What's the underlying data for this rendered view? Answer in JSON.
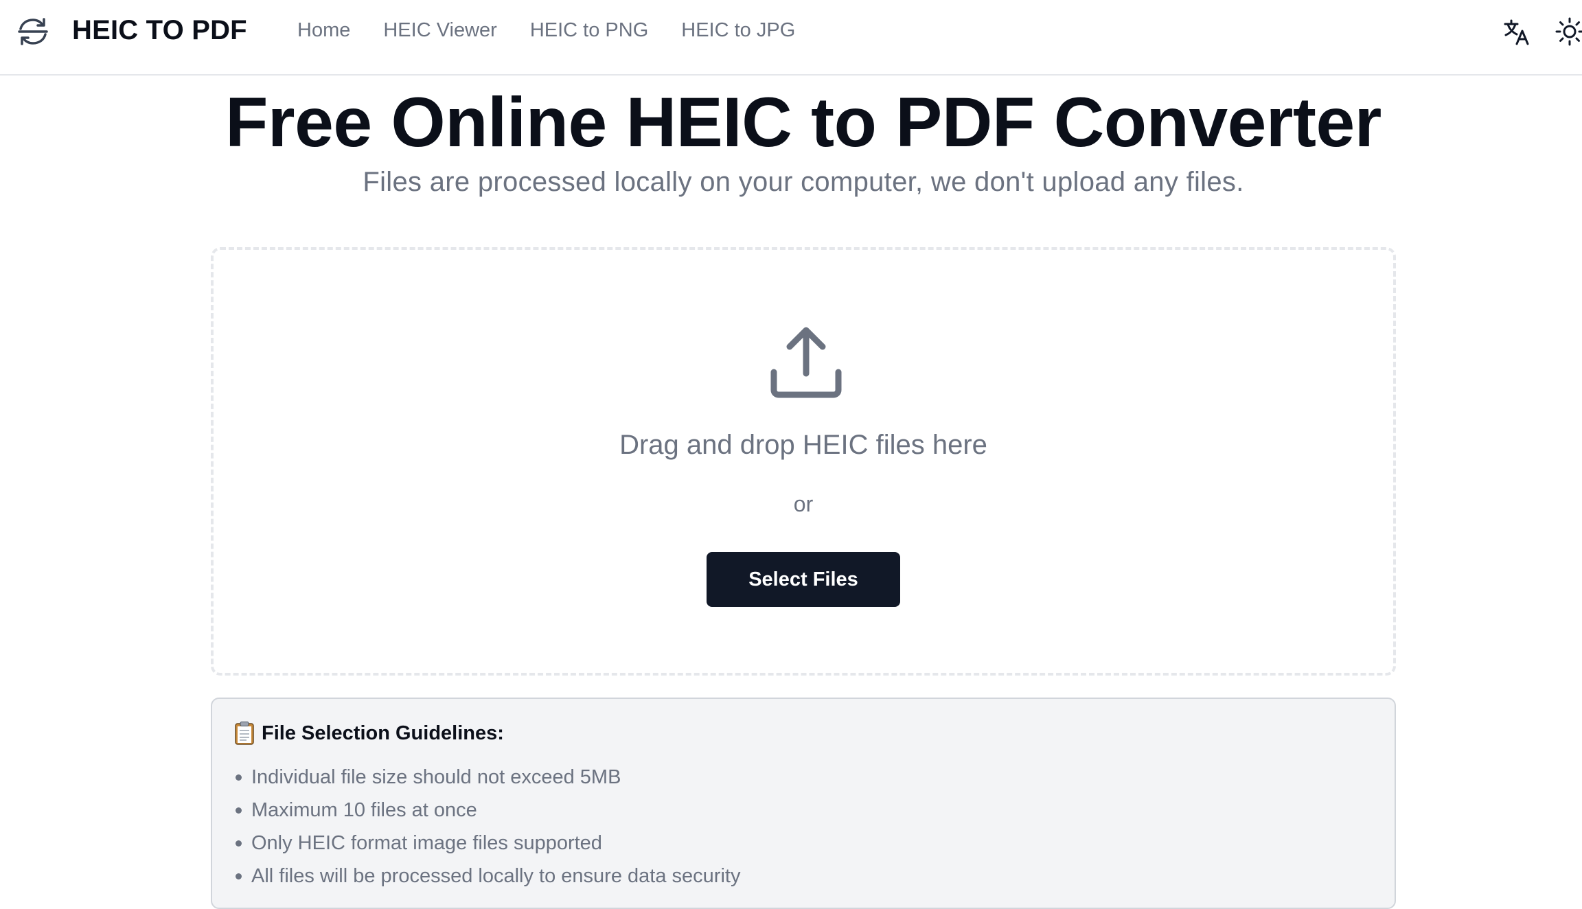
{
  "header": {
    "brand": "HEIC TO PDF",
    "nav": [
      "Home",
      "HEIC Viewer",
      "HEIC to PNG",
      "HEIC to JPG"
    ],
    "icons": {
      "logo": "arrows-exchange-icon",
      "translate": "translate-icon",
      "theme": "sun-icon"
    }
  },
  "hero": {
    "title": "Free Online HEIC to PDF Converter",
    "subtitle": "Files are processed locally on your computer, we don't upload any files."
  },
  "dropzone": {
    "icon": "upload-icon",
    "drag_text": "Drag and drop HEIC files here",
    "or_text": "or",
    "select_label": "Select Files"
  },
  "guidelines": {
    "icon": "clipboard-icon",
    "title": "File Selection Guidelines:",
    "items": [
      "Individual file size should not exceed 5MB",
      "Maximum 10 files at once",
      "Only HEIC format image files supported",
      "All files will be processed locally to ensure data security"
    ]
  },
  "colors": {
    "button_bg": "#111827",
    "muted_text": "#6b7280",
    "guidelines_bg": "#f3f4f6"
  }
}
